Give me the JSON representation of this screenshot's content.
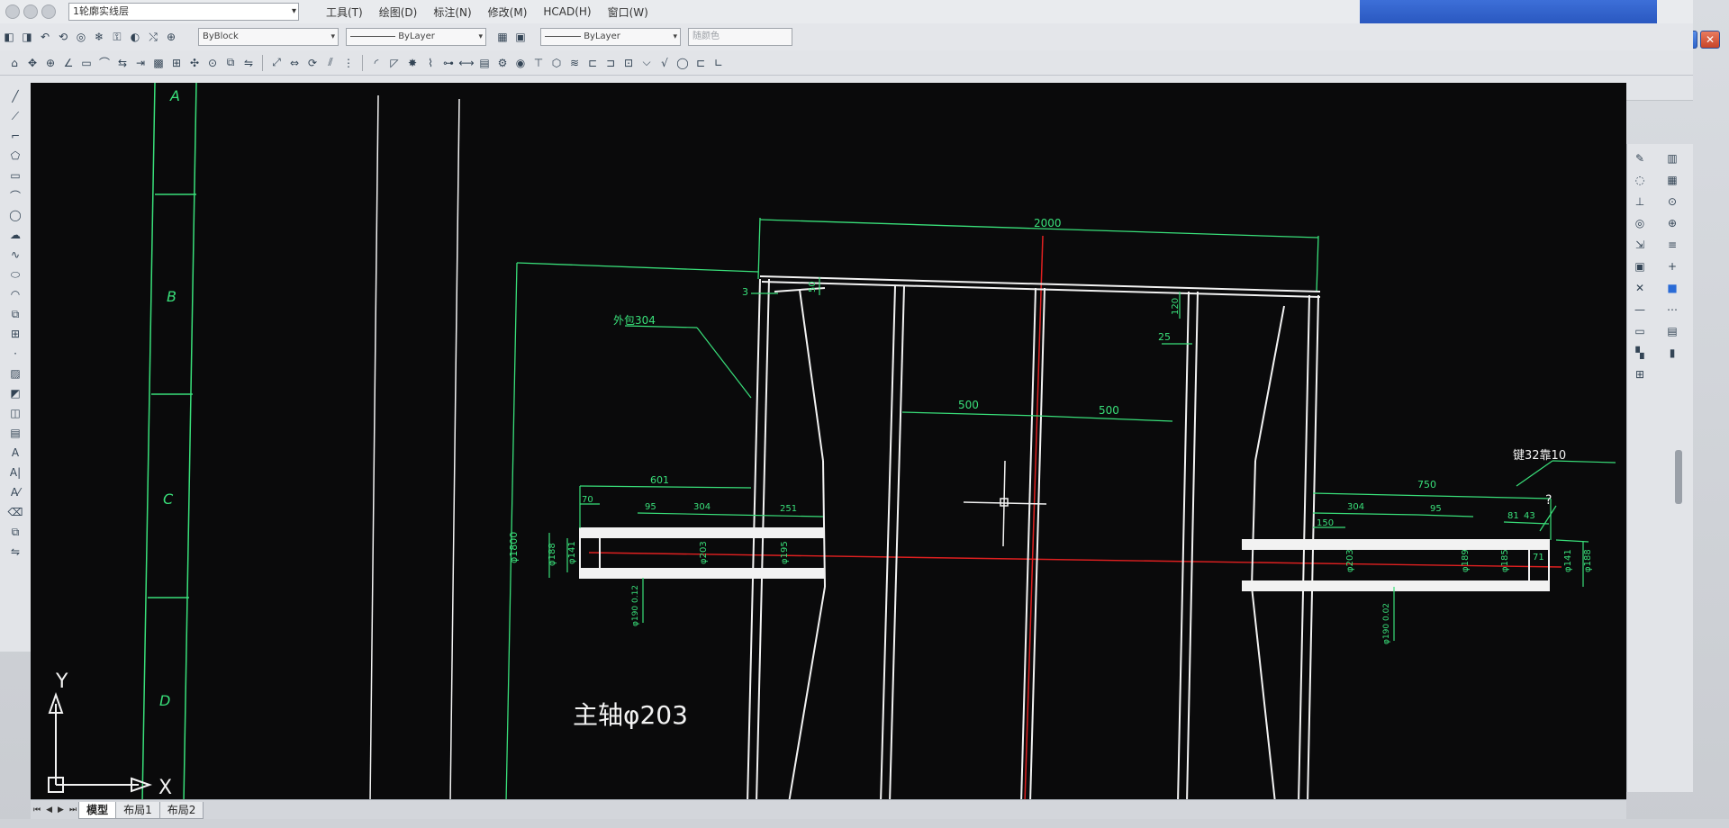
{
  "app": {
    "layer_dropdown": "1轮廓实线层",
    "menus": [
      "工具(T)",
      "绘图(D)",
      "标注(N)",
      "修改(M)",
      "HCAD(H)",
      "窗口(W)"
    ]
  },
  "properties": {
    "color": "ByBlock",
    "linetype": "ByLayer",
    "lineweight": "ByLayer",
    "plotstyle": "随颜色"
  },
  "drawing": {
    "title_blocks": [
      "A",
      "B",
      "C",
      "D"
    ],
    "dims": {
      "overall": "2000",
      "d3": "3",
      "d50": "50",
      "d120": "120",
      "d25": "25",
      "left_half": "500",
      "right_half": "500",
      "dia_drum": "φ1800",
      "left_len": "601",
      "l70": "70",
      "l95": "95",
      "l304": "304",
      "l251": "251",
      "r750": "750",
      "r304": "304",
      "r95": "95",
      "r150": "150",
      "r81": "81",
      "r43": "43",
      "r71": "71",
      "phi188_l": "φ188",
      "phi141_l": "φ141",
      "phi203_l": "φ203",
      "phi195_l": "φ195",
      "phi203_r": "φ203",
      "phi189_r": "φ189",
      "phi185_r": "φ185",
      "phi141_r": "φ141",
      "phi188_r": "φ188",
      "tol_l": "φ190 0.12",
      "tol_r": "φ190 0.02"
    },
    "labels": {
      "shell": "外包304",
      "key": "键32靠10",
      "q": "?",
      "main_shaft": "主轴φ203",
      "axis_y": "Y",
      "axis_x": "X"
    }
  },
  "tabs": [
    "模型",
    "布局1",
    "布局2"
  ],
  "colors": {
    "dim_green": "#39e07a",
    "center_red": "#e02020",
    "line_white": "#f2f2f2",
    "canvas_bg": "#0a0a0b"
  }
}
